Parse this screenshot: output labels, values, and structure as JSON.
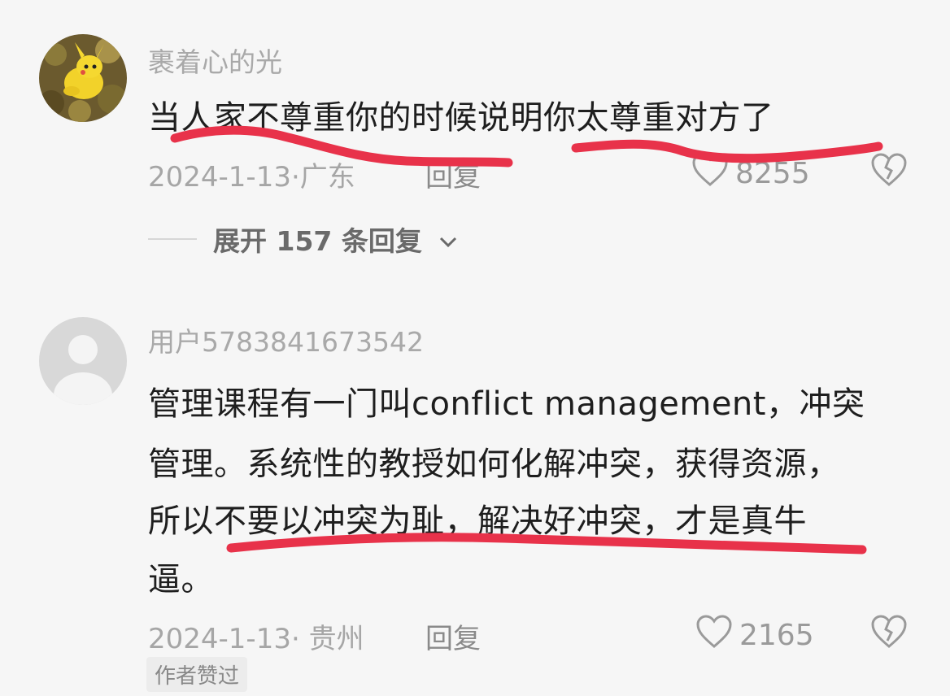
{
  "comments": [
    {
      "username": "裹着心的光",
      "text_lines": [
        "当人家不尊重你的时候说明你太尊重对方了"
      ],
      "date_location": "2024-1-13·广东",
      "reply_label": "回复",
      "like_count": "8255",
      "avatar_icon": "pikachu-avatar"
    },
    {
      "username": "用户5783841673542",
      "text_lines": [
        "管理课程有一门叫conflict management，冲突",
        "管理。系统性的教授如何化解冲突，获得资源，",
        "所以不要以冲突为耻，解决好冲突，才是真牛",
        "逼。"
      ],
      "date_location": "2024-1-13· 贵州",
      "reply_label": "回复",
      "like_count": "2165",
      "badge": "作者赞过",
      "avatar_icon": "default-user-avatar"
    }
  ],
  "expand_replies_label": "展开 157 条回复",
  "colors": {
    "scribble": "#e8324a",
    "meta_text": "#a6a6a6",
    "body_text": "#1e1e1e",
    "background": "#f6f6f6"
  }
}
